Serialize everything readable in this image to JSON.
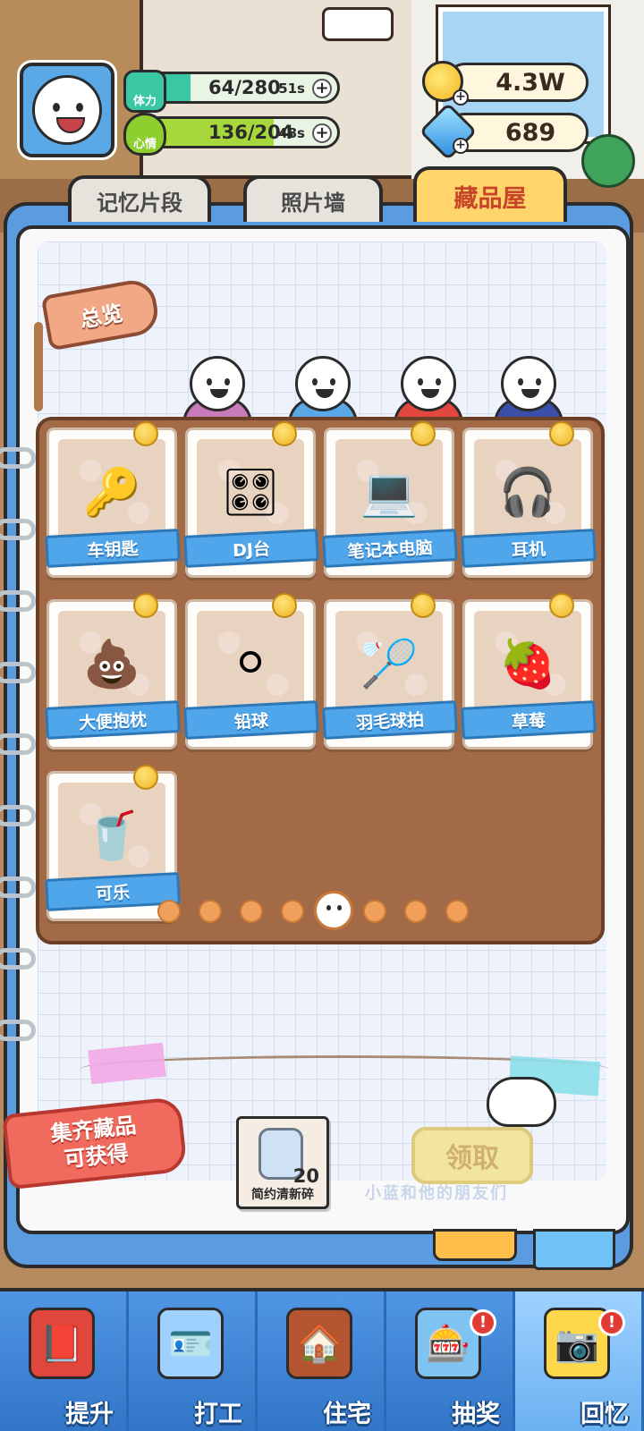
{
  "hud": {
    "stamina": {
      "label": "体力",
      "value": "64/280",
      "timer": "51s",
      "fraction": 0.23
    },
    "mood": {
      "label": "心情",
      "value": "136/204",
      "timer": "48s",
      "fraction": 0.67
    },
    "coins": "4.3W",
    "gems": "689"
  },
  "tabs": [
    {
      "label": "记忆片段"
    },
    {
      "label": "照片墙"
    },
    {
      "label": "藏品屋"
    }
  ],
  "overview_label": "总览",
  "items": [
    {
      "name": "车钥匙",
      "icon": "car-key-icon",
      "glyph": "🔑"
    },
    {
      "name": "DJ台",
      "icon": "dj-deck-icon",
      "glyph": "🎛"
    },
    {
      "name": "笔记本电脑",
      "icon": "laptop-icon",
      "glyph": "💻"
    },
    {
      "name": "耳机",
      "icon": "headphones-icon",
      "glyph": "🎧"
    },
    {
      "name": "大便抱枕",
      "icon": "poop-pillow-icon",
      "glyph": "💩"
    },
    {
      "name": "铅球",
      "icon": "shot-put-icon",
      "glyph": "⚪"
    },
    {
      "name": "羽毛球拍",
      "icon": "badminton-racket-icon",
      "glyph": "🏸"
    },
    {
      "name": "草莓",
      "icon": "strawberry-icon",
      "glyph": "🍓"
    },
    {
      "name": "可乐",
      "icon": "cola-can-icon",
      "glyph": "🥤"
    }
  ],
  "pagination": {
    "total": 8,
    "current": 5
  },
  "reward": {
    "banner_line1": "集齐藏品",
    "banner_line2": "可获得",
    "item_name": "简约清新碎",
    "item_count": "20",
    "claim_label": "领取",
    "watermark": "小蓝和他的朋友们"
  },
  "nav": [
    {
      "label": "提升",
      "icon": "book-icon",
      "glyph": "📕",
      "badge": false
    },
    {
      "label": "打工",
      "icon": "work-badge-icon",
      "glyph": "🪪",
      "badge": false
    },
    {
      "label": "住宅",
      "icon": "house-icon",
      "glyph": "🏠",
      "badge": false
    },
    {
      "label": "抽奖",
      "icon": "gacha-machine-icon",
      "glyph": "🎰",
      "badge": true
    },
    {
      "label": "回忆",
      "icon": "camera-icon",
      "glyph": "📷",
      "badge": true
    }
  ],
  "badge_text": "!",
  "colors": {
    "stamina_fill": "#39c7a4",
    "mood_fill": "#a6d83b",
    "board": "#a36a47",
    "ribbon": "#4fa6ea",
    "nav_bg": "#3f85d6"
  }
}
